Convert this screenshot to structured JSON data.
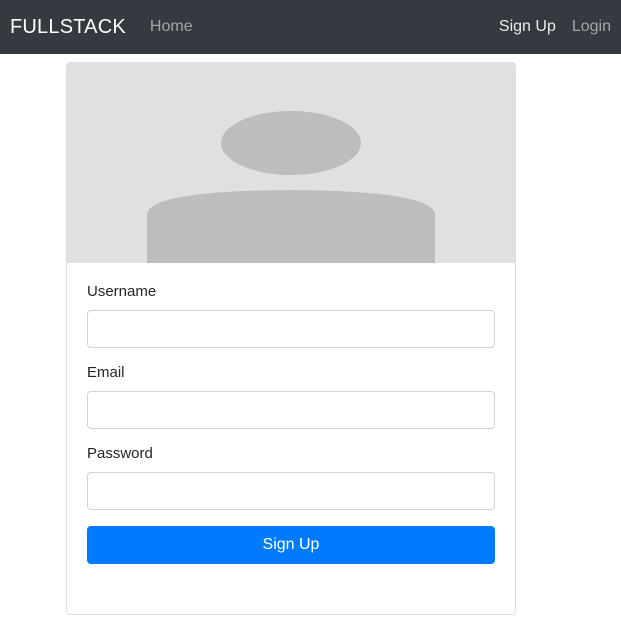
{
  "navbar": {
    "brand": "FULLSTACK",
    "home": "Home",
    "signup": "Sign Up",
    "login": "Login"
  },
  "card": {
    "image_icon": "user-placeholder-icon",
    "fields": {
      "username_label": "Username",
      "username_value": "",
      "email_label": "Email",
      "email_value": "",
      "password_label": "Password",
      "password_value": ""
    },
    "submit_label": "Sign Up"
  },
  "colors": {
    "navbar_bg": "#343a40",
    "primary": "#007bff",
    "placeholder_bg": "#e0e0e0",
    "placeholder_fg": "#bdbdbd"
  }
}
